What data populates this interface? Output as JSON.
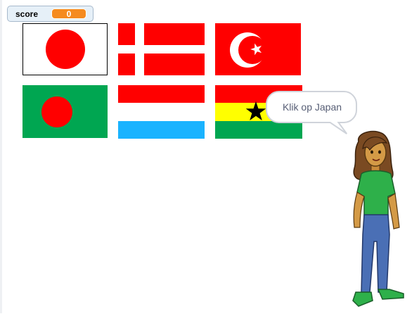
{
  "score": {
    "label": "score",
    "value": "0"
  },
  "speech": {
    "text": "Klik op Japan"
  },
  "flags": [
    {
      "id": "japan",
      "icon": "japan-flag-icon"
    },
    {
      "id": "denmark",
      "icon": "denmark-flag-icon"
    },
    {
      "id": "turkey",
      "icon": "turkey-flag-icon"
    },
    {
      "id": "bangladesh",
      "icon": "bangladesh-flag-icon"
    },
    {
      "id": "luxembourg",
      "icon": "luxembourg-flag-icon"
    },
    {
      "id": "ghana",
      "icon": "ghana-flag-icon"
    }
  ],
  "colors": {
    "score_value_bg": "#f58b1f",
    "monitor_bg": "#e6f0f8",
    "red": "#ff0000",
    "green": "#00a651",
    "yellow": "#ffff00",
    "light_blue": "#1ab3ff"
  }
}
